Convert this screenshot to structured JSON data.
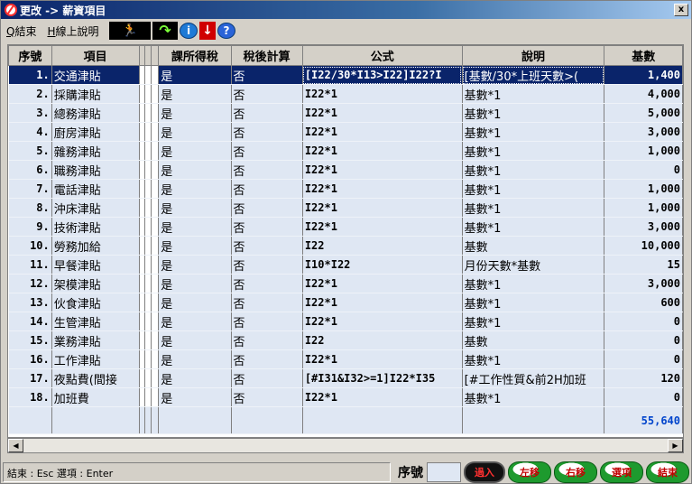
{
  "window": {
    "title": "更改 -> 薪資項目",
    "close": "x"
  },
  "menu": [
    {
      "key": "Q",
      "label": "結束"
    },
    {
      "key": "H",
      "label": "線上說明"
    }
  ],
  "toolbar": {
    "exit_icon": "running-man-icon",
    "refresh_icon": "refresh-arrow-icon",
    "info_icon": "info-icon",
    "down_icon": "down-arrow-icon",
    "help_icon": "help-icon",
    "info_glyph": "i",
    "down_glyph": "↓",
    "help_glyph": "?"
  },
  "columns": {
    "seq": "序號",
    "name": "項目",
    "tax": "課所得稅",
    "after": "稅後計算",
    "formula": "公式",
    "desc": "說明",
    "base": "基數"
  },
  "rows": [
    {
      "seq": "1.",
      "name": "交通津貼",
      "tax": "是",
      "after": "否",
      "formula": "[I22/30*I13>I22]I22?I",
      "desc": "[基數/30*上班天數>(",
      "base": "1,400"
    },
    {
      "seq": "2.",
      "name": "採購津貼",
      "tax": "是",
      "after": "否",
      "formula": "I22*1",
      "desc": "基數*1",
      "base": "4,000"
    },
    {
      "seq": "3.",
      "name": "總務津貼",
      "tax": "是",
      "after": "否",
      "formula": "I22*1",
      "desc": "基數*1",
      "base": "5,000"
    },
    {
      "seq": "4.",
      "name": "廚房津貼",
      "tax": "是",
      "after": "否",
      "formula": "I22*1",
      "desc": "基數*1",
      "base": "3,000"
    },
    {
      "seq": "5.",
      "name": "雜務津貼",
      "tax": "是",
      "after": "否",
      "formula": "I22*1",
      "desc": "基數*1",
      "base": "1,000"
    },
    {
      "seq": "6.",
      "name": "職務津貼",
      "tax": "是",
      "after": "否",
      "formula": "I22*1",
      "desc": "基數*1",
      "base": "0"
    },
    {
      "seq": "7.",
      "name": "電話津貼",
      "tax": "是",
      "after": "否",
      "formula": "I22*1",
      "desc": "基數*1",
      "base": "1,000"
    },
    {
      "seq": "8.",
      "name": "沖床津貼",
      "tax": "是",
      "after": "否",
      "formula": "I22*1",
      "desc": "基數*1",
      "base": "1,000"
    },
    {
      "seq": "9.",
      "name": "技術津貼",
      "tax": "是",
      "after": "否",
      "formula": "I22*1",
      "desc": "基數*1",
      "base": "3,000"
    },
    {
      "seq": "10.",
      "name": "勞務加給",
      "tax": "是",
      "after": "否",
      "formula": "I22",
      "desc": "基數",
      "base": "10,000"
    },
    {
      "seq": "11.",
      "name": "早餐津貼",
      "tax": "是",
      "after": "否",
      "formula": "I10*I22",
      "desc": "月份天數*基數",
      "base": "15"
    },
    {
      "seq": "12.",
      "name": "架模津貼",
      "tax": "是",
      "after": "否",
      "formula": "I22*1",
      "desc": "基數*1",
      "base": "3,000"
    },
    {
      "seq": "13.",
      "name": "伙食津貼",
      "tax": "是",
      "after": "否",
      "formula": "I22*1",
      "desc": "基數*1",
      "base": "600"
    },
    {
      "seq": "14.",
      "name": "生管津貼",
      "tax": "是",
      "after": "否",
      "formula": "I22*1",
      "desc": "基數*1",
      "base": "0"
    },
    {
      "seq": "15.",
      "name": "業務津貼",
      "tax": "是",
      "after": "否",
      "formula": "I22",
      "desc": "基數",
      "base": "0"
    },
    {
      "seq": "16.",
      "name": "工作津貼",
      "tax": "是",
      "after": "否",
      "formula": "I22*1",
      "desc": "基數*1",
      "base": "0"
    },
    {
      "seq": "17.",
      "name": "夜點費(間接",
      "tax": "是",
      "after": "否",
      "formula": "[#I31&I32>=1]I22*I35",
      "desc": "[#工作性質&前2H加班",
      "base": "120"
    },
    {
      "seq": "18.",
      "name": "加班費",
      "tax": "是",
      "after": "否",
      "formula": "I22*1",
      "desc": "基數*1",
      "base": "0"
    }
  ],
  "total": "55,640",
  "status": {
    "hint": "結束 : Esc  選項 : Enter",
    "seq_label": "序號",
    "seq_value": "",
    "buttons": [
      "過入",
      "左移",
      "右移",
      "選項",
      "結束"
    ]
  },
  "colors": {
    "selection": "#0a246a",
    "row_bg": "#dfe7f3",
    "total_text": "#0044cc"
  }
}
